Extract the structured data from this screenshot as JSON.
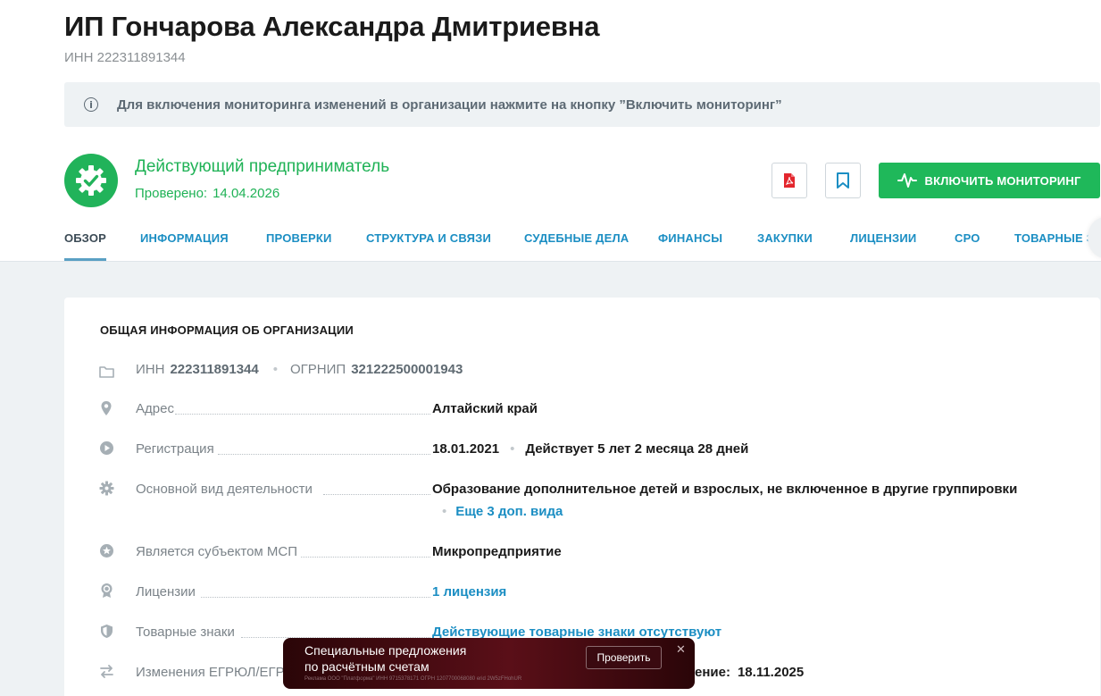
{
  "header": {
    "title": "ИП Гончарова Александра Дмитриевна",
    "inn_subtitle": "ИНН 222311891344"
  },
  "notice": {
    "icon": "info-icon",
    "text": "Для включения мониторинга изменений в организации нажмите на кнопку ”Включить мониторинг”"
  },
  "status": {
    "icon": "verified-gear-check-icon",
    "title": "Действующий предприниматель",
    "checked_label": "Проверено:",
    "checked_date": "14.04.2026"
  },
  "actions": {
    "pdf_icon": "pdf-icon",
    "bookmark_icon": "bookmark-icon",
    "monitor_label": "ВКЛЮЧИТЬ МОНИТОРИНГ",
    "monitor_icon": "pulse-icon"
  },
  "tabs": [
    {
      "label": "ОБЗОР",
      "active": true
    },
    {
      "label": "ИНФОРМАЦИЯ"
    },
    {
      "label": "ПРОВЕРКИ"
    },
    {
      "label": "СТРУКТУРА И СВЯЗИ"
    },
    {
      "label": "СУДЕБНЫЕ ДЕЛА"
    },
    {
      "label": "ФИНАНСЫ"
    },
    {
      "label": "ЗАКУПКИ"
    },
    {
      "label": "ЛИЦЕНЗИИ"
    },
    {
      "label": "СРО"
    },
    {
      "label": "ТОВАРНЫЕ ЗНАКИ"
    }
  ],
  "card": {
    "title": "ОБЩАЯ ИНФОРМАЦИЯ ОБ ОРГАНИЗАЦИИ",
    "inn_label": "ИНН",
    "inn_value": "222311891344",
    "ogrnip_label": "ОГРНИП",
    "ogrnip_value": "321222500001943",
    "address_label": "Адрес",
    "address_value": "Алтайский край",
    "registration_label": "Регистрация",
    "registration_date": "18.01.2021",
    "registration_duration": "Действует 5 лет 2 месяца 28 дней",
    "activity_label": "Основной вид деятельности",
    "activity_value": "Образование дополнительное детей и взрослых, не включенное в другие группировки",
    "activity_more": "Еще 3 доп. вида",
    "msp_label": "Является субъектом МСП",
    "msp_value": "Микропредприятие",
    "licenses_label": "Лицензии",
    "licenses_value": "1 лицензия",
    "trademarks_label": "Товарные знаки",
    "trademarks_value": "Действующие товарные знаки отсутствуют",
    "changes_label": "Изменения ЕГРЮЛ/ЕГР",
    "changes_value_tail": "ение:",
    "changes_date": "18.11.2025"
  },
  "ad": {
    "line1": "Специальные предложения",
    "line2": "по расчётным счетам",
    "legal": "Реклама ООО \"Платформа\" ИНН 9715378171 ОГРН 1207700068080 erid 2W5zFHohUR",
    "button": "Проверить",
    "close": "✕"
  }
}
